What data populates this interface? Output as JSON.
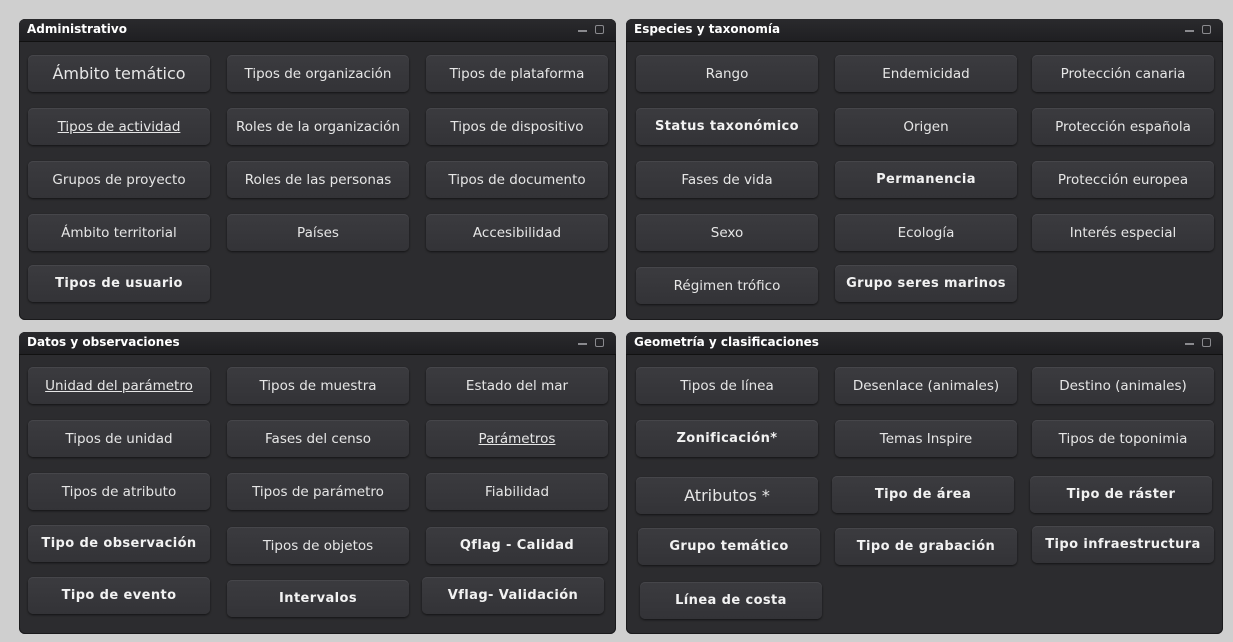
{
  "panels": [
    {
      "title": "Administrativo",
      "buttons": [
        "Ámbito temático",
        "Tipos de organización",
        "Tipos de plataforma",
        "Tipos de actividad",
        "Roles de la organización",
        "Tipos de dispositivo",
        "Grupos de proyecto",
        "Roles de las personas",
        "Tipos de documento",
        "Ámbito territorial",
        "Países",
        "Accesibilidad",
        "Tipos de usuario"
      ]
    },
    {
      "title": "Especies y taxonomía",
      "buttons": [
        "Rango",
        "Endemicidad",
        "Protección canaria",
        "Status taxonómico",
        "Origen",
        "Protección española",
        "Fases de vida",
        "Permanencia",
        "Protección europea",
        "Sexo",
        "Ecología",
        "Interés especial",
        "Régimen trófico",
        "Grupo seres marinos"
      ]
    },
    {
      "title": "Datos y observaciones",
      "buttons": [
        "Unidad del parámetro",
        "Tipos de muestra",
        "Estado del mar",
        "Tipos de unidad",
        "Fases del censo",
        "Parámetros",
        "Tipos de atributo",
        "Tipos de parámetro",
        "Fiabilidad",
        "Tipo de observación",
        "Tipos de objetos",
        "Qflag - Calidad",
        "Tipo de evento",
        "Intervalos",
        "Vflag- Validación"
      ]
    },
    {
      "title": "Geometría y clasificaciones",
      "buttons": [
        "Tipos de línea",
        "Desenlace (animales)",
        "Destino (animales)",
        "Zonificación*",
        "Temas Inspire",
        "Tipos de toponimia",
        "Atributos *",
        "Tipo de área",
        "Tipo de ráster",
        "Grupo temático",
        "Tipo de grabación",
        "Tipo infraestructura",
        "Línea de costa"
      ]
    }
  ]
}
